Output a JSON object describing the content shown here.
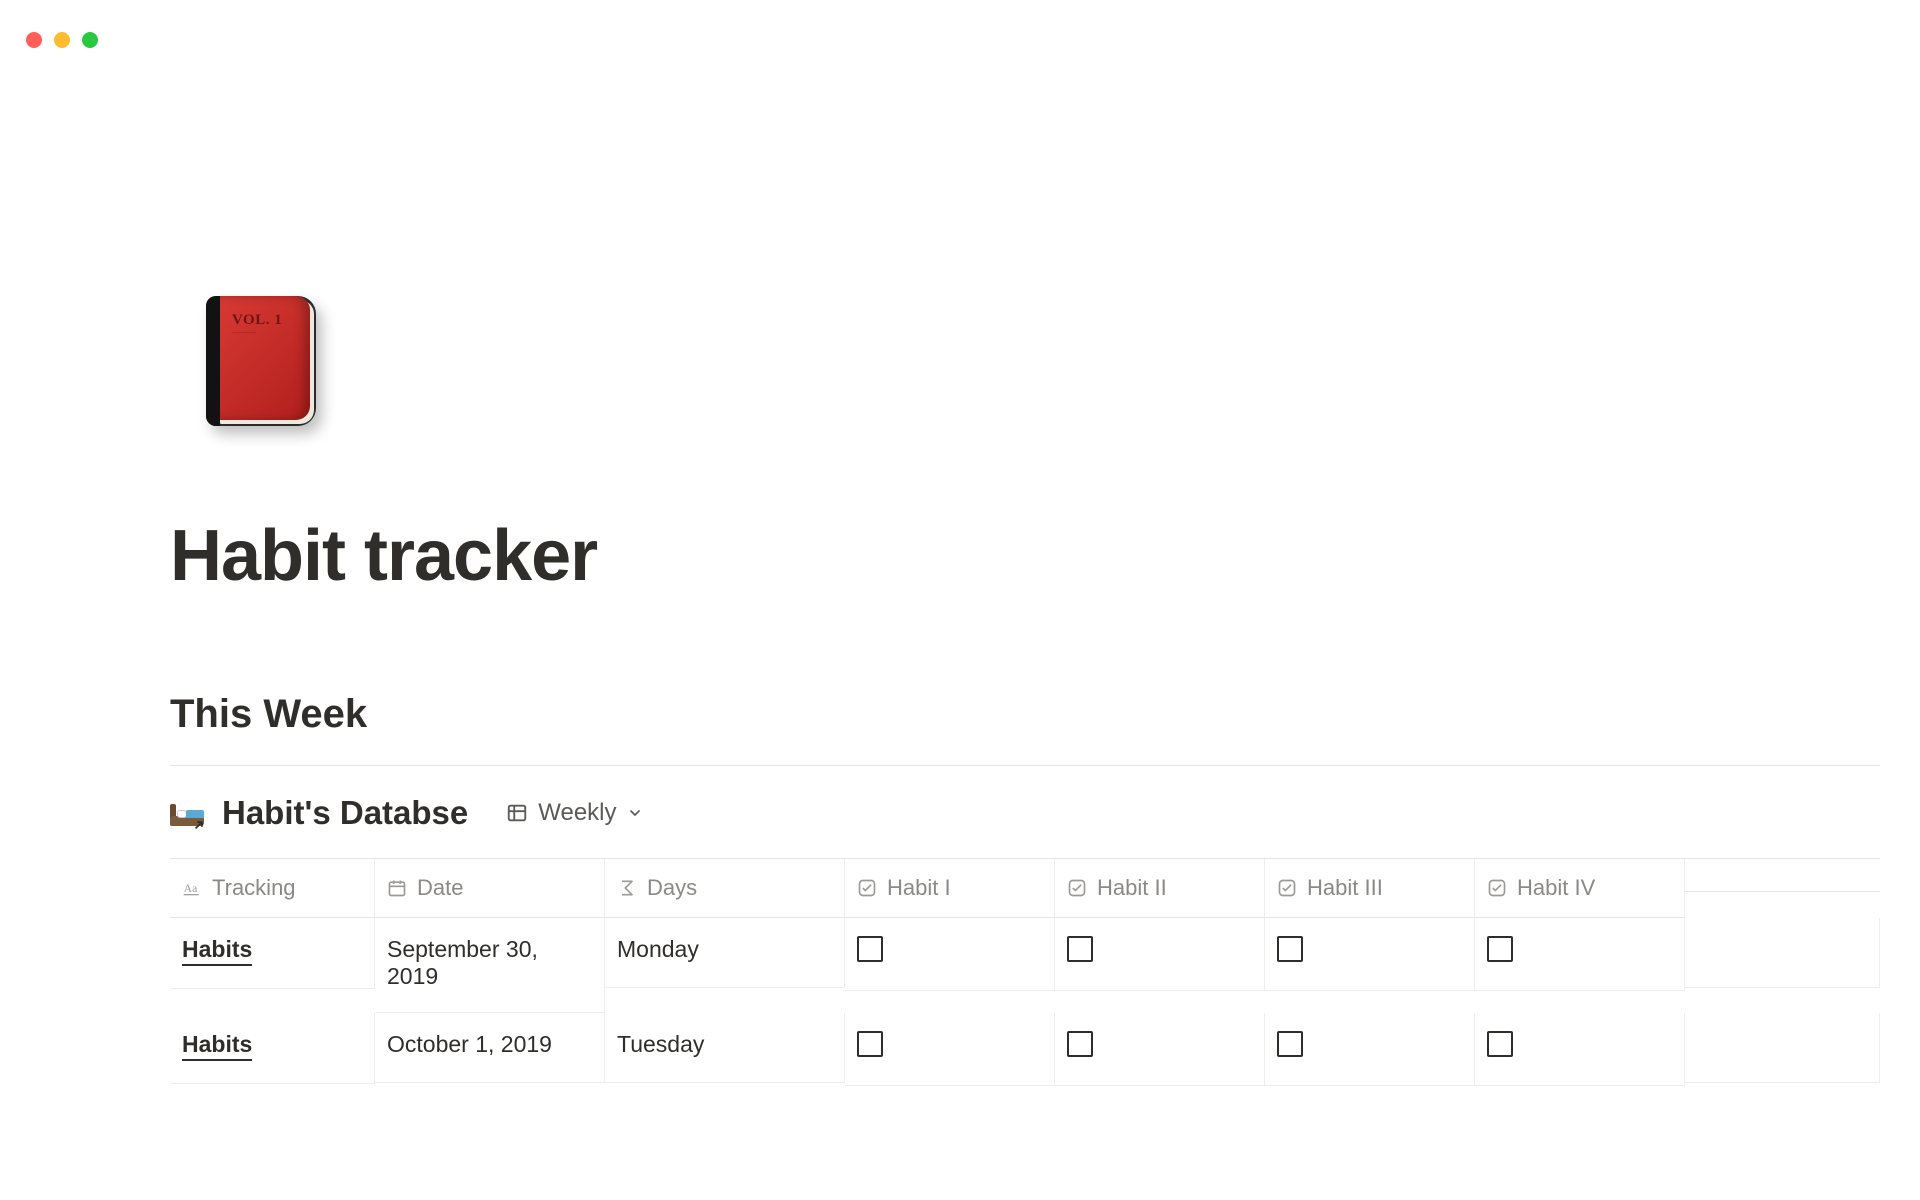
{
  "window": {
    "traffic": [
      "close",
      "minimize",
      "maximize"
    ]
  },
  "page": {
    "icon_label": "VOL. 1",
    "title": "Habit tracker",
    "section_heading": "This Week"
  },
  "database": {
    "title": "Habit's Databse",
    "view_label": "Weekly"
  },
  "columns": [
    {
      "key": "tracking",
      "label": "Tracking",
      "type": "title"
    },
    {
      "key": "date",
      "label": "Date",
      "type": "date"
    },
    {
      "key": "days",
      "label": "Days",
      "type": "formula"
    },
    {
      "key": "habit1",
      "label": "Habit I",
      "type": "checkbox"
    },
    {
      "key": "habit2",
      "label": "Habit II",
      "type": "checkbox"
    },
    {
      "key": "habit3",
      "label": "Habit III",
      "type": "checkbox"
    },
    {
      "key": "habit4",
      "label": "Habit IV",
      "type": "checkbox"
    }
  ],
  "rows": [
    {
      "tracking": "Habits",
      "date": "September 30, 2019",
      "days": "Monday",
      "habit1": false,
      "habit2": false,
      "habit3": false,
      "habit4": false
    },
    {
      "tracking": "Habits",
      "date": "October 1, 2019",
      "days": "Tuesday",
      "habit1": false,
      "habit2": false,
      "habit3": false,
      "habit4": false
    }
  ]
}
